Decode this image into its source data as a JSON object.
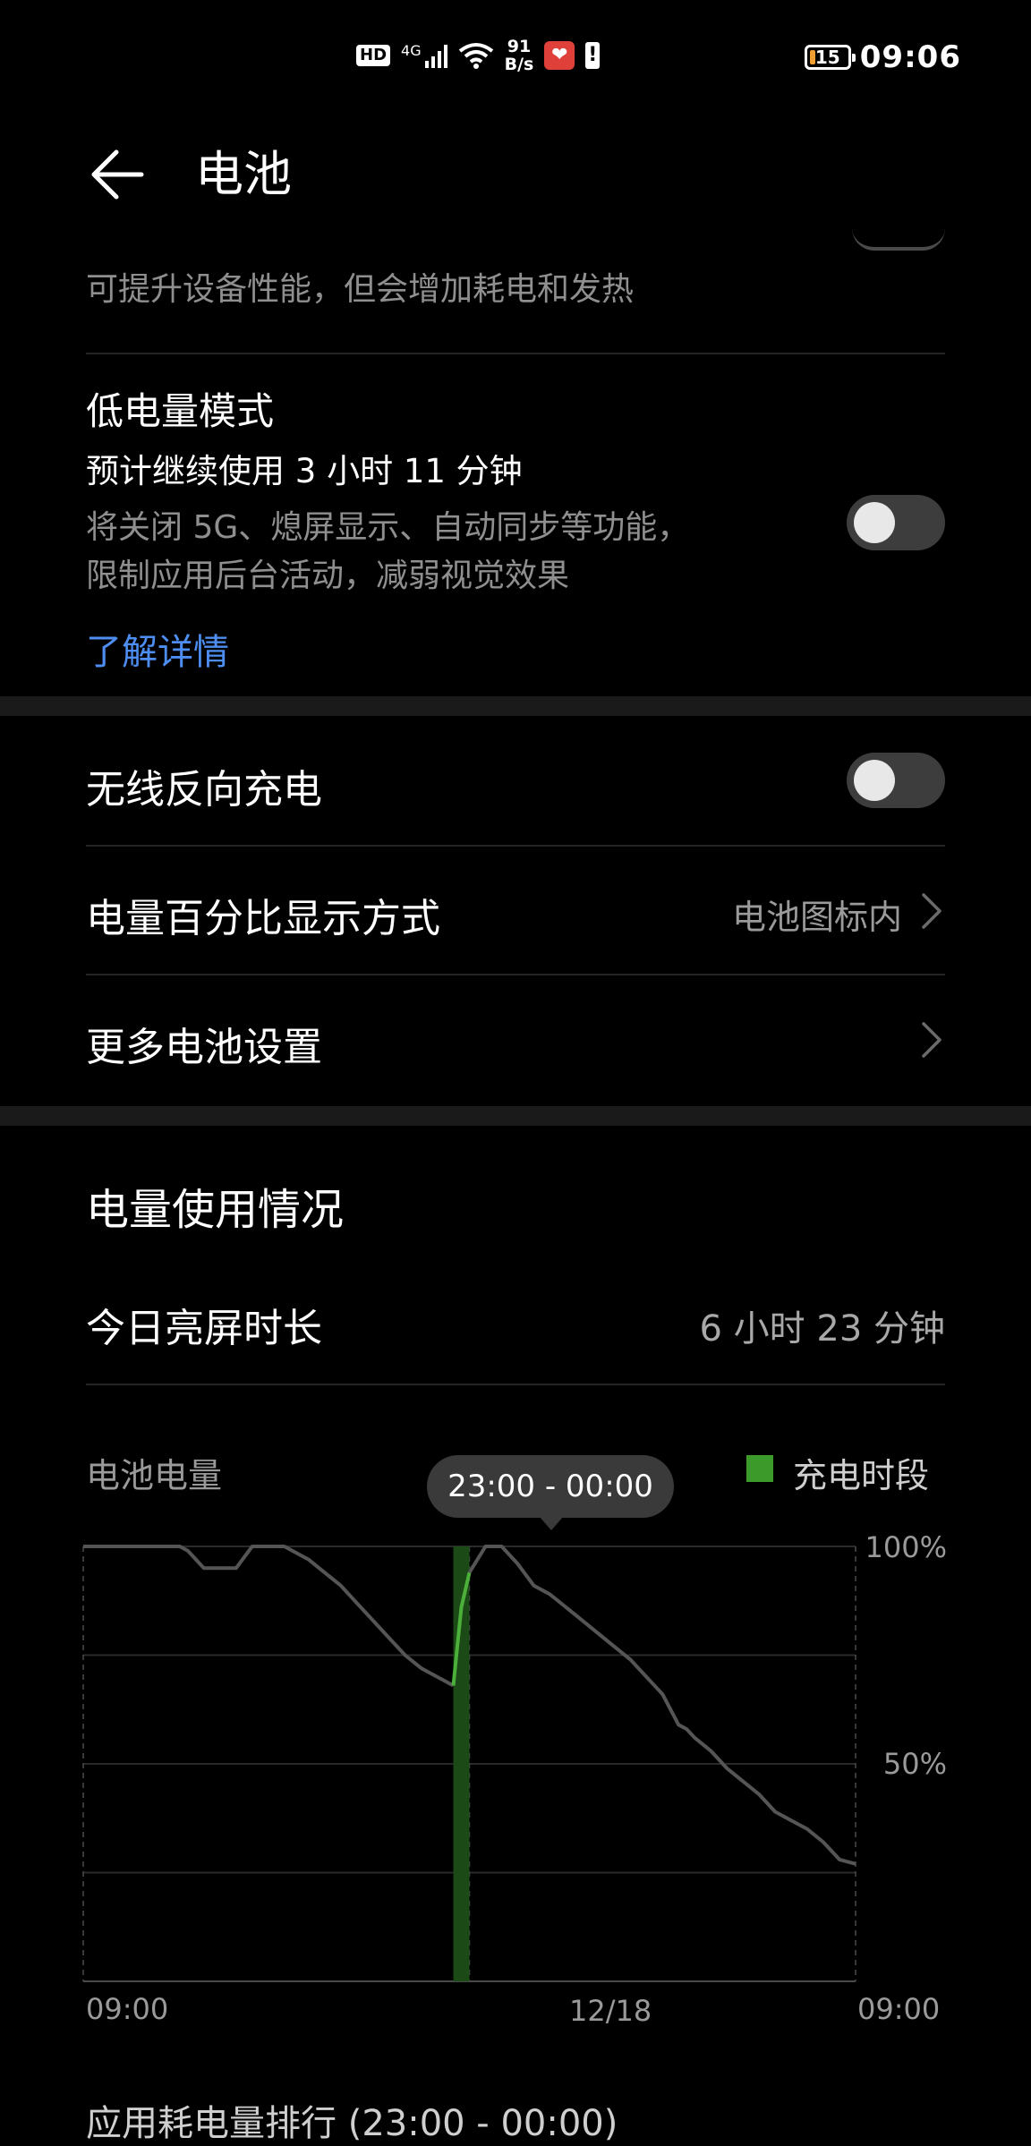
{
  "status_bar": {
    "hd": "HD",
    "network": "4G",
    "speed_value": "91",
    "speed_unit": "B/s",
    "app_notification_icon": "heart-app-icon",
    "alert_icon": "exclamation-icon",
    "battery_level": "15",
    "time": "09:06"
  },
  "header": {
    "title": "电池"
  },
  "performance": {
    "description": "可提升设备性能，但会增加耗电和发热"
  },
  "low_power": {
    "title": "低电量模式",
    "estimate": "预计继续使用 3 小时 11 分钟",
    "description_line1": "将关闭 5G、熄屏显示、自动同步等功能，",
    "description_line2": "限制应用后台活动，减弱视觉效果",
    "learn_more": "了解详情",
    "enabled": false
  },
  "settings": {
    "wireless_reverse_charge": {
      "label": "无线反向充电",
      "enabled": false
    },
    "percentage_display": {
      "label": "电量百分比显示方式",
      "value": "电池图标内"
    },
    "more_settings": {
      "label": "更多电池设置"
    }
  },
  "usage": {
    "section_title": "电量使用情况",
    "screen_time_label": "今日亮屏时长",
    "screen_time_value": "6 小时 23 分钟"
  },
  "chart_labels": {
    "title": "电池电量",
    "legend": "充电时段",
    "tooltip": "23:00 - 00:00",
    "y_top": "100%",
    "y_mid": "50%",
    "x_start": "09:00",
    "x_mid": "12/18",
    "x_end": "09:00"
  },
  "chart_data": {
    "type": "line",
    "title": "电池电量",
    "x_range": [
      "09:00",
      "09:00"
    ],
    "x_ticks": [
      "09:00",
      "12/18",
      "09:00"
    ],
    "ylim": [
      0,
      100
    ],
    "y_ticks": [
      "50%",
      "100%"
    ],
    "grid": true,
    "legend": [
      "充电时段"
    ],
    "highlight": {
      "label": "23:00 - 00:00",
      "start_hour": 23,
      "end_hour": 24
    },
    "x_hours": [
      0,
      2.5,
      3.5,
      4.5,
      5,
      6,
      6.5,
      7.0,
      7.5,
      8.0,
      8.5,
      9.5,
      10.5,
      11.0,
      11.5,
      12.0,
      12.5,
      13.5,
      14.0,
      15.0,
      16.0,
      17.0,
      18.0,
      19.0,
      20.0,
      21.0,
      22.0,
      23.0,
      23.5,
      24.0,
      25.0,
      26.0,
      27.0,
      28.0,
      29.0,
      30.0,
      31.0,
      32.0,
      33.0,
      34.0,
      35.0,
      36.0,
      37.0,
      37.5,
      38.0,
      39.0,
      40.0,
      41.0,
      42.0,
      43.0,
      44.0,
      45.0,
      46.0,
      47.0,
      48.0
    ],
    "battery_percent": [
      100,
      100,
      100,
      100,
      100,
      100,
      99,
      97,
      95,
      95,
      95,
      95,
      100,
      100,
      100,
      100,
      100,
      98,
      97,
      94,
      91,
      87,
      83,
      79,
      75,
      72,
      70,
      68,
      86,
      94,
      100,
      100,
      96,
      91,
      89,
      86,
      83,
      80,
      77,
      74,
      70,
      66,
      59,
      58,
      56,
      53,
      49,
      46,
      43,
      39,
      37,
      35,
      32,
      28,
      27
    ]
  }
}
